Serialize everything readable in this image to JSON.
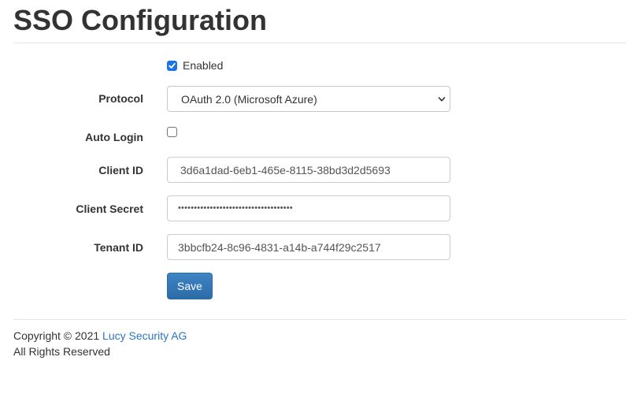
{
  "page": {
    "title": "SSO Configuration"
  },
  "form": {
    "enabled": {
      "label": "Enabled",
      "checked": true
    },
    "protocol": {
      "label": "Protocol",
      "selected": "OAuth 2.0 (Microsoft Azure)"
    },
    "auto_login": {
      "label": "Auto Login",
      "checked": false
    },
    "client_id": {
      "label": "Client ID",
      "value": "3d6a1dad-6eb1-465e-8115-38bd3d2d5693"
    },
    "client_secret": {
      "label": "Client Secret",
      "value": "••••••••••••••••••••••••••••••••••••"
    },
    "tenant_id": {
      "label": "Tenant ID",
      "value": "3bbcfb24-8c96-4831-a14b-a744f29c2517"
    },
    "save_label": "Save"
  },
  "footer": {
    "copyright_prefix": "Copyright © 2021 ",
    "company_link": "Lucy Security AG",
    "rights": "All Rights Reserved"
  },
  "colors": {
    "accent": "#1a73e8",
    "button": "#337ab7",
    "link": "#2a75c4",
    "text": "#333333"
  },
  "icons": {
    "select_arrow": "chevron-down-icon",
    "checkbox_check": "check-icon"
  }
}
